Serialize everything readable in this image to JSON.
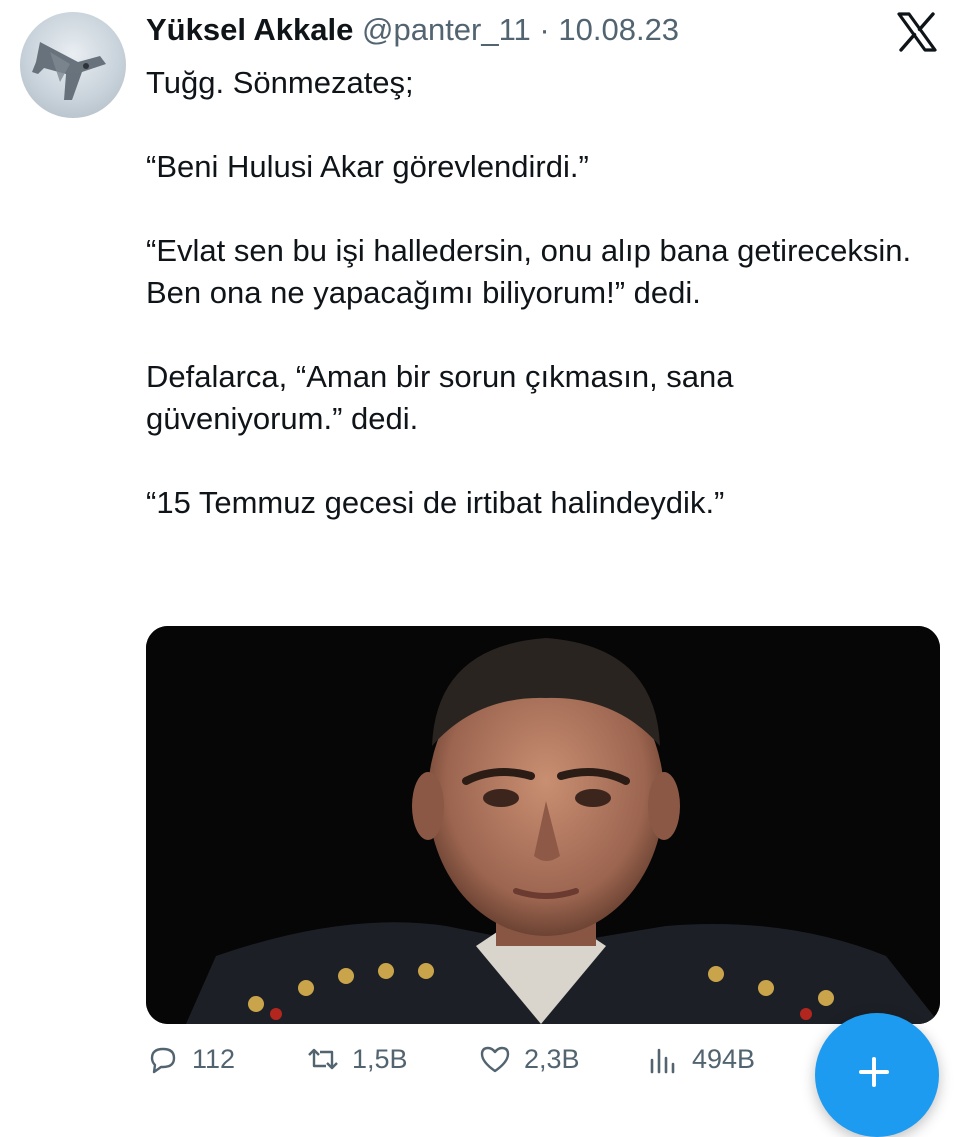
{
  "tweet": {
    "author_name": "Yüksel Akkale",
    "handle": "@panter_11",
    "separator": "·",
    "date": "10.08.23",
    "paragraphs": [
      "Tuğg. Sönmezateş;",
      "“Beni Hulusi Akar görevlendirdi.”",
      "“Evlat sen bu işi halledersin, onu alıp bana getireceksin. Ben ona ne yapacağımı biliyorum!” dedi.",
      "Defalarca, “Aman bir sorun çıkmasın, sana güveniyorum.” dedi.",
      "“15 Temmuz gecesi de irtibat halindeydik.”"
    ]
  },
  "stats": {
    "replies": "112",
    "retweets": "1,5B",
    "likes": "2,3B",
    "views": "494B"
  },
  "icons": {
    "brand": "x-logo-icon",
    "reply": "reply-icon",
    "retweet": "retweet-icon",
    "like": "heart-icon",
    "views": "views-icon",
    "compose": "plus-icon"
  },
  "colors": {
    "text": "#0f1419",
    "secondary": "#536471",
    "accent": "#1d9bf0"
  }
}
